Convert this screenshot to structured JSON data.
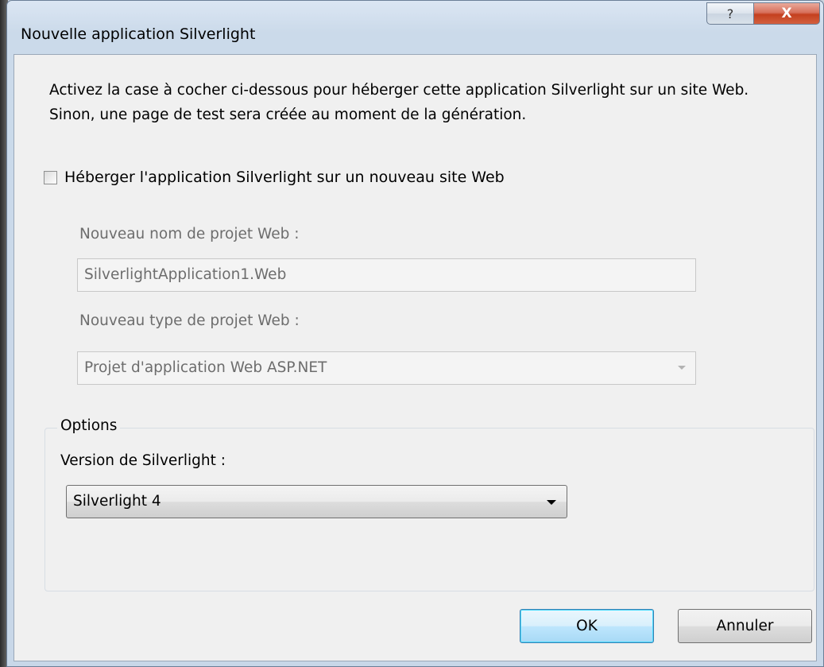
{
  "window": {
    "title": "Nouvelle application Silverlight",
    "help_glyph": "?",
    "close_glyph": "X"
  },
  "intro": {
    "text": "Activez la case à cocher ci-dessous pour héberger cette application Silverlight sur un site Web. Sinon, une page de test sera créée au moment de la génération."
  },
  "host_checkbox": {
    "label": "Héberger l'application Silverlight sur un nouveau site Web",
    "checked": false
  },
  "web_project": {
    "name_label": "Nouveau nom de projet Web :",
    "name_value": "SilverlightApplication1.Web",
    "type_label": "Nouveau type de projet Web :",
    "type_value": "Projet d'application Web ASP.NET"
  },
  "options": {
    "group_title": "Options",
    "version_label": "Version de Silverlight :",
    "version_value": "Silverlight 4"
  },
  "buttons": {
    "ok": "OK",
    "cancel": "Annuler"
  },
  "colors": {
    "ok_button_border": "#3c7fb1",
    "close_button": "#c4401f",
    "disabled_text": "#6d6d6d"
  }
}
